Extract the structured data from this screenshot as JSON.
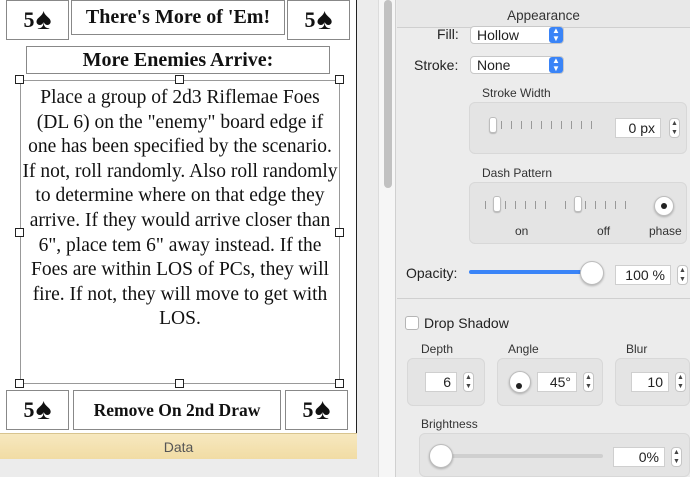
{
  "card": {
    "corner_value": "5",
    "corner_symbol": "♠",
    "title": "There's More of 'Em!",
    "header": "More Enemies Arrive:",
    "body": "Place a group of 2d3 Riflemae Foes (DL 6) on the \"enemy\" board edge if one has been specified by the scenario. If not, roll randomly. Also roll randomly to determine where on that edge they arrive. If they would arrive closer than 6\", place tem 6\" away instead. If the Foes are within LOS of PCs, they will fire. If not, they will move to get with LOS.",
    "footer": "Remove On 2nd Draw"
  },
  "data_bar": {
    "label": "Data"
  },
  "inspector": {
    "header": "Appearance",
    "fill": {
      "label": "Fill:",
      "value": "Hollow"
    },
    "stroke": {
      "label": "Stroke:",
      "value": "None"
    },
    "stroke_width": {
      "label": "Stroke Width",
      "value": "0 px",
      "fraction": 0.0
    },
    "dash_pattern": {
      "label": "Dash Pattern",
      "on_label": "on",
      "off_label": "off",
      "phase_label": "phase"
    },
    "opacity": {
      "label": "Opacity:",
      "value": "100 %",
      "fraction": 1.0
    },
    "drop_shadow": {
      "label": "Drop Shadow",
      "checked": false,
      "depth": {
        "label": "Depth",
        "value": "6"
      },
      "angle": {
        "label": "Angle",
        "value": "45°"
      },
      "blur": {
        "label": "Blur",
        "value": "10"
      },
      "brightness": {
        "label": "Brightness",
        "value": "0%",
        "fraction": 0.0
      }
    }
  },
  "colors": {
    "accent": "#3a84f7",
    "data_bar": "#f3e0ad"
  },
  "icons": {
    "stepper": "up-down-stepper-icon",
    "popup": "chevron-up-down-icon"
  }
}
